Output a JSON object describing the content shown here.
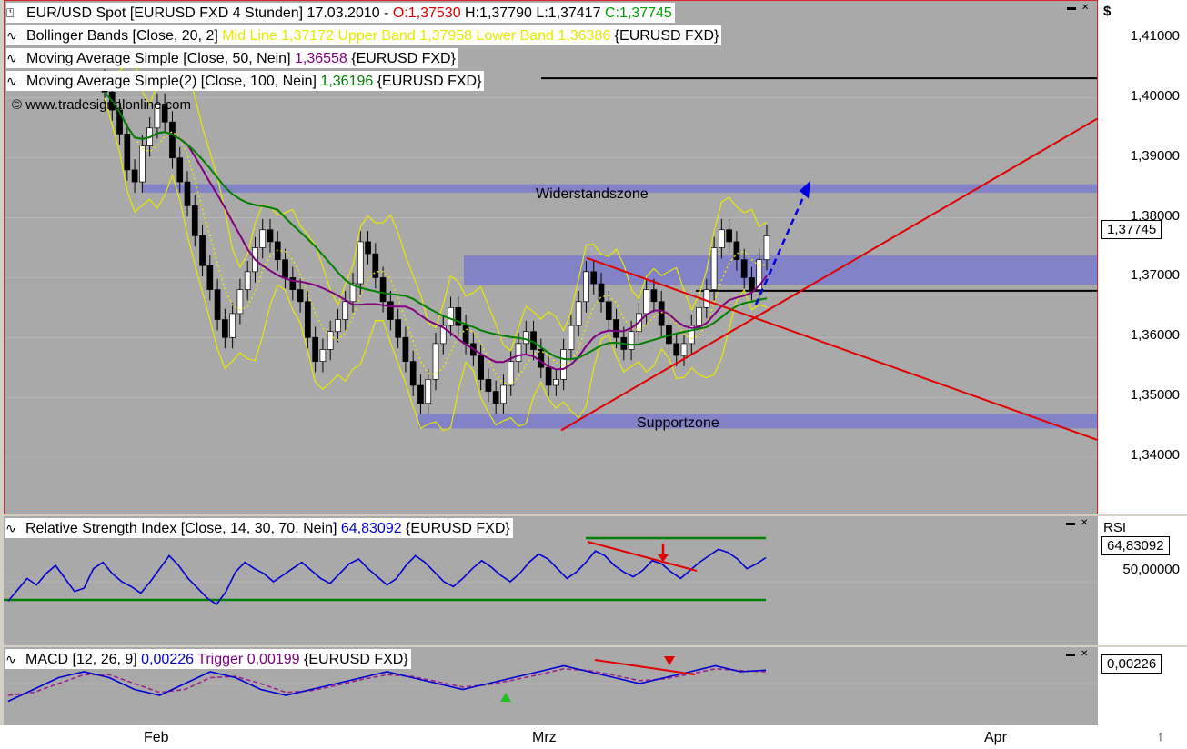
{
  "headers": {
    "price": {
      "prefix": "EUR/USD Spot [EURUSD FXD  4 Stunden] 17.03.2010 - ",
      "o": "O:1,37530",
      "h": " H:1,37790",
      "l": " L:1,37417",
      "c": " C:1,37745"
    },
    "bb": {
      "prefix": "Bollinger Bands [Close, 20, 2] ",
      "vals": "Mid Line 1,37172 Upper Band 1,37958 Lower Band 1,36386",
      "suffix": " {EURUSD FXD}"
    },
    "ma50": {
      "prefix": "Moving Average Simple [Close, 50, Nein] ",
      "val": "1,36558",
      "suffix": " {EURUSD FXD}"
    },
    "ma100": {
      "prefix": "Moving Average Simple(2) [Close, 100, Nein] ",
      "val": "1,36196",
      "suffix": " {EURUSD FXD}"
    },
    "copyright": "© www.tradesignalonline.com",
    "rsi": {
      "prefix": "Relative Strength Index [Close, 14, 30, 70, Nein] ",
      "val": "64,83092",
      "suffix": " {EURUSD FXD}"
    },
    "macd": {
      "prefix": "MACD [12, 26, 9] ",
      "val": "0,00226",
      "trig": " Trigger 0,00199",
      "suffix": " {EURUSD FXD}"
    }
  },
  "axes": {
    "unit": "$",
    "price_ticks": [
      "1,41000",
      "1,40000",
      "1,39000",
      "1,38000",
      "1,37000",
      "1,36000",
      "1,35000",
      "1,34000"
    ],
    "last_price": "1,37745",
    "rsi_unit": "RSI",
    "rsi_last": "64,83092",
    "rsi_ticks": [
      "50,00000"
    ],
    "macd_last": "0,00226",
    "x_labels": [
      "Feb",
      "Mrz",
      "Apr"
    ]
  },
  "zones": {
    "resistance": "Widerstandszone",
    "support": "Supportzone"
  },
  "colors": {
    "bg": "#a9a9a9",
    "zone": "#7b7bcc",
    "trend": "#e00000",
    "bb": "#e8e800",
    "ma50": "#800080",
    "ma100": "#008000",
    "rsi": "#0000d0"
  },
  "chart_data": [
    {
      "type": "candlestick",
      "title": "EUR/USD Spot [EURUSD FXD  4 Stunden] 17.03.2010",
      "x_labels": [
        "Feb",
        "Mrz",
        "Apr"
      ],
      "ylim": [
        1.335,
        1.415
      ],
      "last": {
        "open": 1.3753,
        "high": 1.3779,
        "low": 1.37417,
        "close": 1.37745
      },
      "closes": [
        1.401,
        1.398,
        1.394,
        1.388,
        1.386,
        1.392,
        1.395,
        1.399,
        1.396,
        1.39,
        1.386,
        1.382,
        1.377,
        1.372,
        1.368,
        1.363,
        1.36,
        1.364,
        1.368,
        1.371,
        1.375,
        1.378,
        1.376,
        1.373,
        1.37,
        1.368,
        1.366,
        1.36,
        1.356,
        1.358,
        1.361,
        1.363,
        1.366,
        1.369,
        1.376,
        1.374,
        1.37,
        1.366,
        1.363,
        1.36,
        1.356,
        1.352,
        1.349,
        1.353,
        1.359,
        1.362,
        1.365,
        1.362,
        1.359,
        1.357,
        1.353,
        1.351,
        1.349,
        1.352,
        1.356,
        1.359,
        1.361,
        1.358,
        1.355,
        1.352,
        1.353,
        1.358,
        1.362,
        1.366,
        1.371,
        1.369,
        1.366,
        1.363,
        1.36,
        1.358,
        1.361,
        1.364,
        1.368,
        1.366,
        1.362,
        1.359,
        1.357,
        1.359,
        1.362,
        1.365,
        1.368,
        1.375,
        1.378,
        1.376,
        1.373,
        1.37,
        1.368,
        1.373,
        1.377
      ],
      "bollinger": {
        "period": 20,
        "mult": 2,
        "mid": 1.37172,
        "upper": 1.37958,
        "lower": 1.36386
      },
      "ma50": 1.36558,
      "ma100": 1.36196,
      "zones": [
        {
          "name": "Widerstandszone",
          "from": 1.3842,
          "to": 1.3856
        },
        {
          "name": "Supportzone",
          "from": 1.3448,
          "to": 1.3472
        },
        {
          "name": "",
          "from": 1.3688,
          "to": 1.3737
        }
      ],
      "hlines": [
        1.4033,
        1.3678
      ]
    },
    {
      "type": "line",
      "title": "Relative Strength Index [Close, 14, 30, 70, Nein]",
      "series": [
        {
          "name": "RSI",
          "values": [
            38,
            45,
            52,
            48,
            55,
            60,
            52,
            44,
            46,
            58,
            62,
            55,
            50,
            47,
            43,
            50,
            58,
            66,
            60,
            52,
            46,
            40,
            36,
            44,
            56,
            62,
            58,
            55,
            50,
            54,
            58,
            62,
            57,
            52,
            49,
            55,
            61,
            64,
            58,
            53,
            48,
            52,
            60,
            66,
            62,
            56,
            50,
            47,
            52,
            58,
            63,
            59,
            54,
            50,
            55,
            62,
            67,
            64,
            58,
            52,
            56,
            62,
            69,
            66,
            60,
            56,
            53,
            57,
            63,
            61,
            56,
            52,
            57,
            62,
            66,
            70,
            68,
            64,
            58,
            61,
            64.83
          ]
        }
      ],
      "levels": [
        70,
        30
      ],
      "last": 64.83092
    },
    {
      "type": "line",
      "title": "MACD [12, 26, 9]",
      "series": [
        {
          "name": "MACD",
          "values": [
            -0.003,
            -0.001,
            0.001,
            0.002,
            0.001,
            -0.001,
            -0.002,
            0.0,
            0.002,
            0.001,
            -0.001,
            -0.002,
            -0.001,
            0.0,
            0.001,
            0.002,
            0.001,
            0.0,
            -0.001,
            0.0,
            0.001,
            0.002,
            0.003,
            0.002,
            0.001,
            0.0,
            0.001,
            0.002,
            0.003,
            0.002,
            0.00226
          ]
        },
        {
          "name": "Trigger",
          "values": [
            -0.002,
            -0.0015,
            0.0,
            0.0015,
            0.0015,
            0.0,
            -0.0015,
            -0.001,
            0.001,
            0.0012,
            0.0,
            -0.0015,
            -0.0012,
            -0.0003,
            0.0007,
            0.0015,
            0.0012,
            0.0003,
            -0.0006,
            -0.0002,
            0.0006,
            0.0015,
            0.0025,
            0.0022,
            0.0014,
            0.0005,
            0.0008,
            0.0016,
            0.0025,
            0.0022,
            0.00199
          ]
        }
      ],
      "last": 0.00226,
      "trigger_last": 0.00199
    }
  ]
}
